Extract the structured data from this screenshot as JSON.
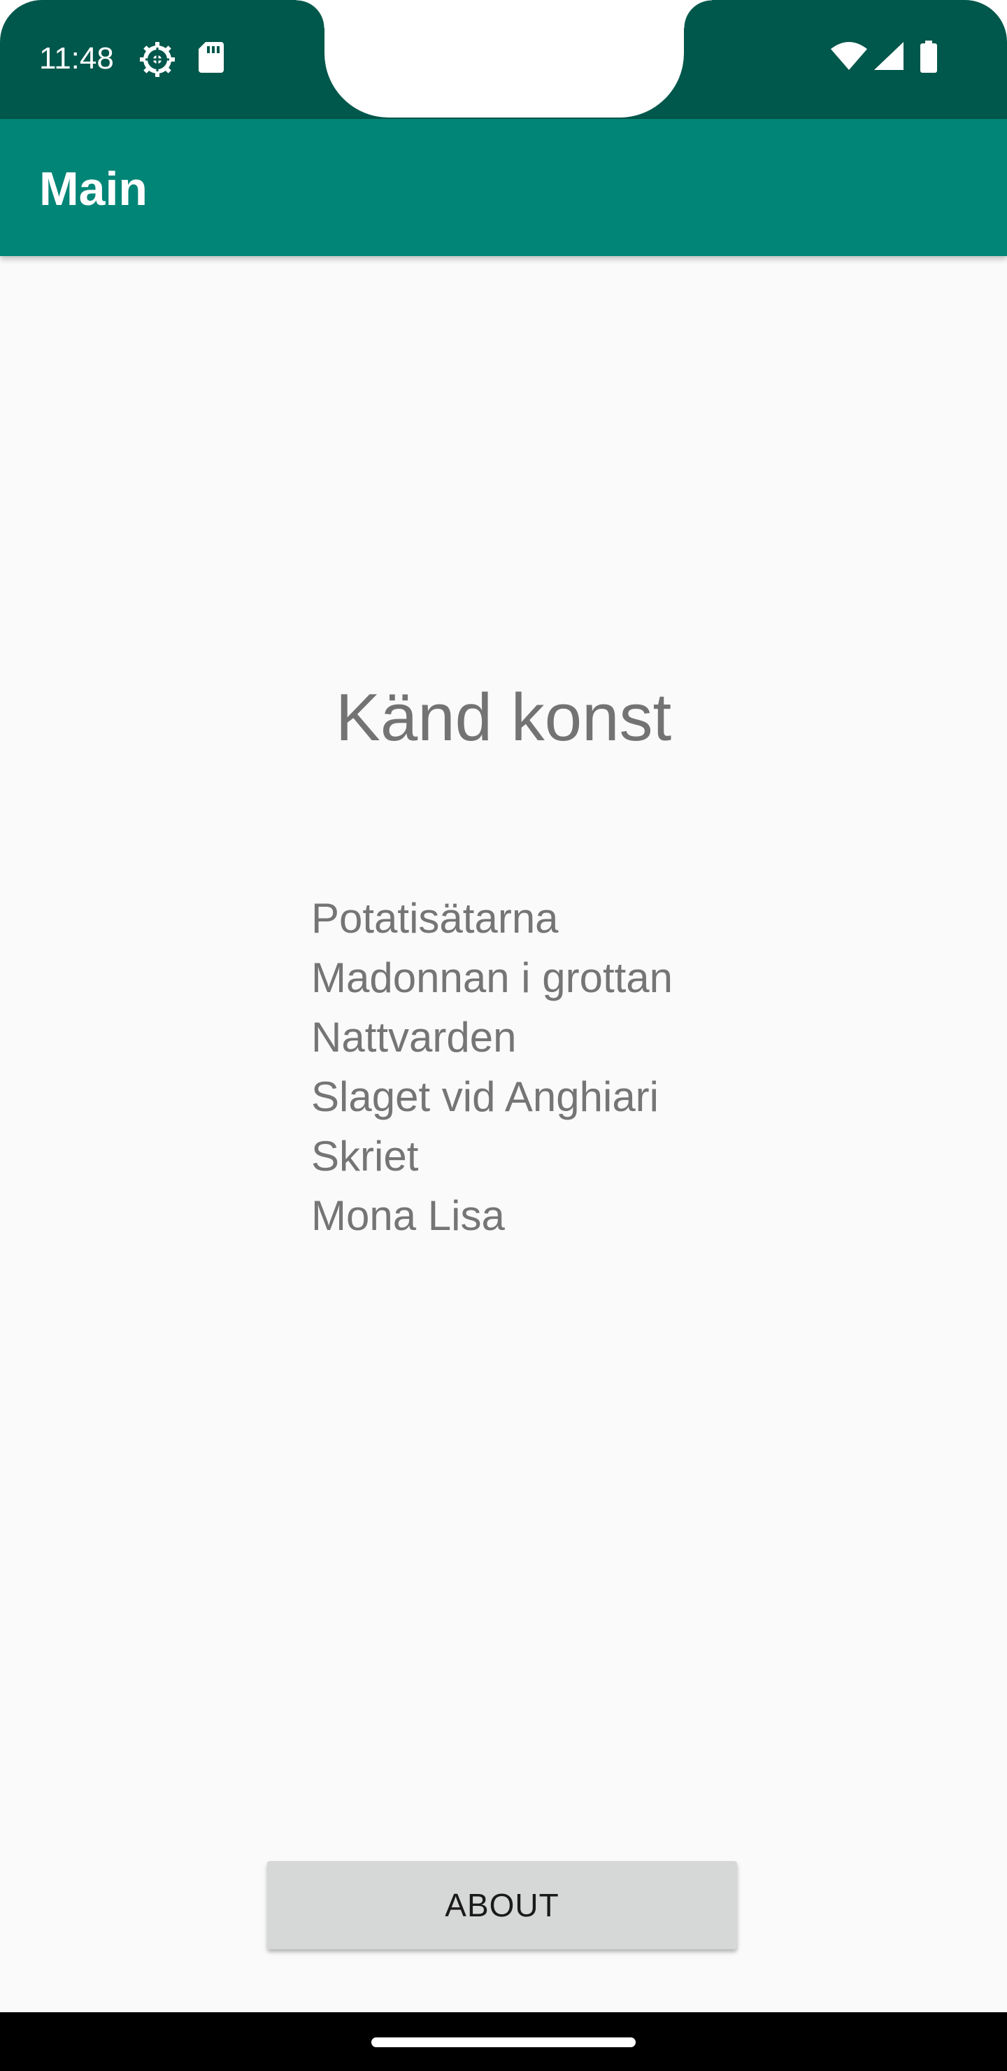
{
  "status_bar": {
    "time": "11:48",
    "icons": [
      "gear-icon",
      "sd-card-icon",
      "wifi-icon",
      "cell-signal-icon",
      "battery-icon"
    ]
  },
  "app_bar": {
    "title": "Main"
  },
  "content": {
    "heading": "Känd konst",
    "artworks": [
      "Potatisätarna",
      "Madonnan i grottan",
      "Nattvarden",
      "Slaget vid Anghiari",
      "Skriet",
      "Mona Lisa"
    ]
  },
  "actions": {
    "about_label": "ABOUT"
  },
  "colors": {
    "status_bar": "#00574B",
    "app_bar": "#008577",
    "background": "#FAFAFA",
    "button": "#D6D7D7",
    "text_gray": "#757575"
  }
}
